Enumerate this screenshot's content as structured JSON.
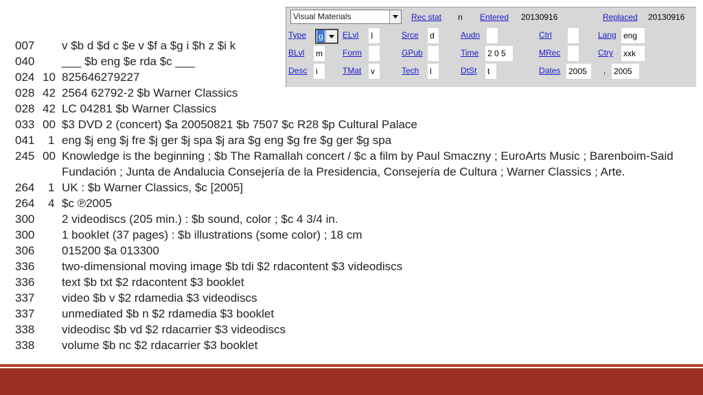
{
  "fixed_field": {
    "type_of_record_select": "Visual Materials",
    "rec_stat": {
      "label": "Rec stat",
      "value": "n"
    },
    "entered": {
      "label": "Entered",
      "value": "20130916"
    },
    "replaced": {
      "label": "Replaced",
      "value": "20130916"
    },
    "type": {
      "label": "Type",
      "value": "g"
    },
    "elvl": {
      "label": "ELvl",
      "value": "I"
    },
    "srce": {
      "label": "Srce",
      "value": "d"
    },
    "audn": {
      "label": "Audn",
      "value": ""
    },
    "ctrl": {
      "label": "Ctrl",
      "value": ""
    },
    "lang": {
      "label": "Lang",
      "value": "eng"
    },
    "blvl": {
      "label": "BLvl",
      "value": "m"
    },
    "form": {
      "label": "Form",
      "value": ""
    },
    "gpub": {
      "label": "GPub",
      "value": ""
    },
    "time": {
      "label": "Time",
      "value": "2 0 5"
    },
    "mrec": {
      "label": "MRec",
      "value": ""
    },
    "ctry": {
      "label": "Ctry",
      "value": "xxk"
    },
    "desc": {
      "label": "Desc",
      "value": "i"
    },
    "tmat": {
      "label": "TMat",
      "value": "v"
    },
    "tech": {
      "label": "Tech",
      "value": "l"
    },
    "dtst": {
      "label": "DtSt",
      "value": "t"
    },
    "dates": {
      "label": "Dates",
      "value1": "2005",
      "separator": ",",
      "value2": "2005"
    }
  },
  "marc_fields": [
    {
      "tag": "007",
      "ind": "",
      "value": "v $b d $d c $e v $f a $g i $h z $i k"
    },
    {
      "tag": "040",
      "ind": "",
      "value": "___ $b eng $e rda $c ___"
    },
    {
      "tag": "024",
      "ind": "10",
      "value": "825646279227"
    },
    {
      "tag": "028",
      "ind": "42",
      "value": "2564 62792-2 $b Warner Classics"
    },
    {
      "tag": "028",
      "ind": "42",
      "value": "LC 04281 $b Warner Classics"
    },
    {
      "tag": "033",
      "ind": "00",
      "value": "$3 DVD 2 (concert) $a 20050821 $b 7507 $c R28 $p Cultural Palace"
    },
    {
      "tag": "041",
      "ind": "1",
      "value": "eng $j eng $j fre $j ger $j spa $j ara $g eng $g fre $g ger $g spa"
    },
    {
      "tag": "245",
      "ind": "00",
      "value": "Knowledge is the beginning ; $b The Ramallah concert / $c a film by Paul Smaczny ; EuroArts Music ; Barenboim-Said",
      "continuation": "Fundación ; Junta de Andalucia Consejería de la Presidencia, Consejería de Cultura ; Warner Classics ; Arte."
    },
    {
      "tag": "264",
      "ind": "1",
      "value": "UK : $b Warner Classics, $c [2005]"
    },
    {
      "tag": "264",
      "ind": "4",
      "value": "$c ℗2005"
    },
    {
      "tag": "300",
      "ind": "",
      "value": "2 videodiscs (205 min.) : $b sound, color ; $c 4 3/4 in."
    },
    {
      "tag": "300",
      "ind": "",
      "value": "1 booklet (37 pages) : $b illustrations (some color) ; 18 cm"
    },
    {
      "tag": "306",
      "ind": "",
      "value": "015200 $a 013300"
    },
    {
      "tag": "336",
      "ind": "",
      "value": "two-dimensional moving image $b tdi $2 rdacontent $3 videodiscs"
    },
    {
      "tag": "336",
      "ind": "",
      "value": "text $b txt $2 rdacontent $3 booklet"
    },
    {
      "tag": "337",
      "ind": "",
      "value": "video $b v $2 rdamedia $3 videodiscs"
    },
    {
      "tag": "337",
      "ind": "",
      "value": "unmediated $b n $2 rdamedia $3 booklet"
    },
    {
      "tag": "338",
      "ind": "",
      "value": "videodisc $b vd $2 rdacarrier $3 videodiscs"
    },
    {
      "tag": "338",
      "ind": "",
      "value": "volume $b nc $2 rdacarrier $3 booklet"
    }
  ],
  "colors": {
    "link": "#1a1acc",
    "panel": "#d7d7d7",
    "band": "#9b2e22",
    "band_thin": "#b8402a"
  }
}
